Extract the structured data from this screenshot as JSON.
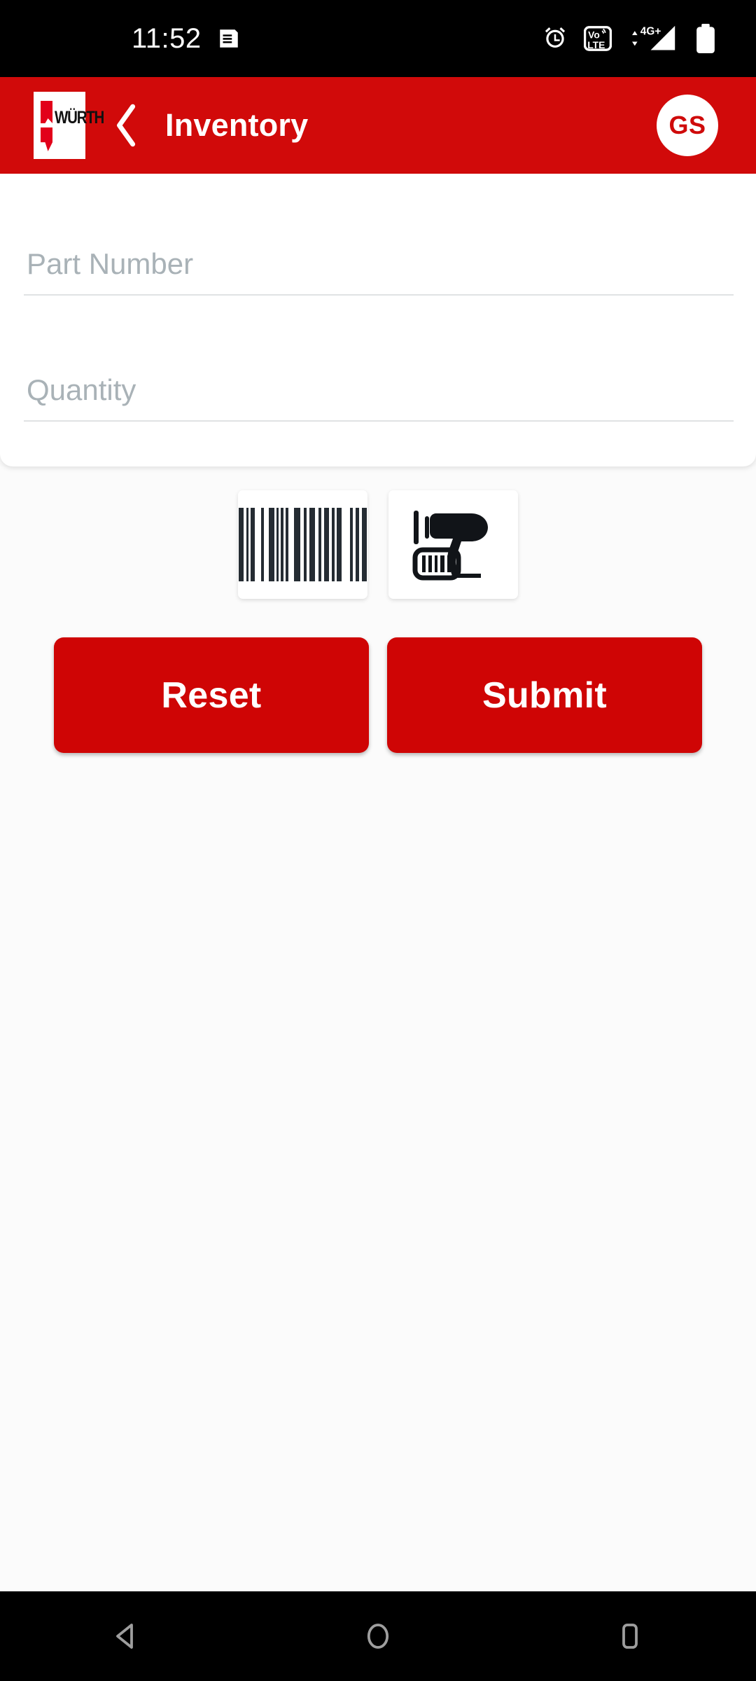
{
  "status_bar": {
    "time": "11:52",
    "left_icons": [
      {
        "name": "message-icon",
        "glyph": "message"
      }
    ],
    "right_icons": [
      {
        "name": "alarm-icon",
        "glyph": "alarm"
      },
      {
        "name": "volte-icon",
        "label_top": "Vo",
        "label_bottom": "LTE"
      },
      {
        "name": "mobile-data-icon",
        "label": "4G+"
      },
      {
        "name": "signal-icon",
        "glyph": "signal"
      },
      {
        "name": "battery-icon",
        "glyph": "battery"
      }
    ],
    "background_color": "#000000",
    "foreground_color": "#ffffff"
  },
  "app_bar": {
    "brand_name": "WÜRTH",
    "back_label": "Back",
    "title": "Inventory",
    "avatar_initials": "GS",
    "background_color": "#d10a0a",
    "title_color": "#ffffff"
  },
  "form": {
    "fields": [
      {
        "name": "part-number",
        "placeholder": "Part Number",
        "value": ""
      },
      {
        "name": "quantity",
        "placeholder": "Quantity",
        "value": ""
      }
    ]
  },
  "scan_tools": [
    {
      "name": "barcode-icon",
      "label": "Barcode"
    },
    {
      "name": "barcode-scanner-icon",
      "label": "Scanner"
    }
  ],
  "actions": {
    "reset_label": "Reset",
    "submit_label": "Submit",
    "button_color": "#cf0505",
    "button_text_color": "#ffffff"
  },
  "nav_bar": {
    "buttons": [
      {
        "name": "nav-back-button",
        "glyph": "triangle-left"
      },
      {
        "name": "nav-home-button",
        "glyph": "circle"
      },
      {
        "name": "nav-recents-button",
        "glyph": "rounded-square"
      }
    ],
    "background_color": "#000000",
    "icon_color": "#9e9e9e"
  }
}
